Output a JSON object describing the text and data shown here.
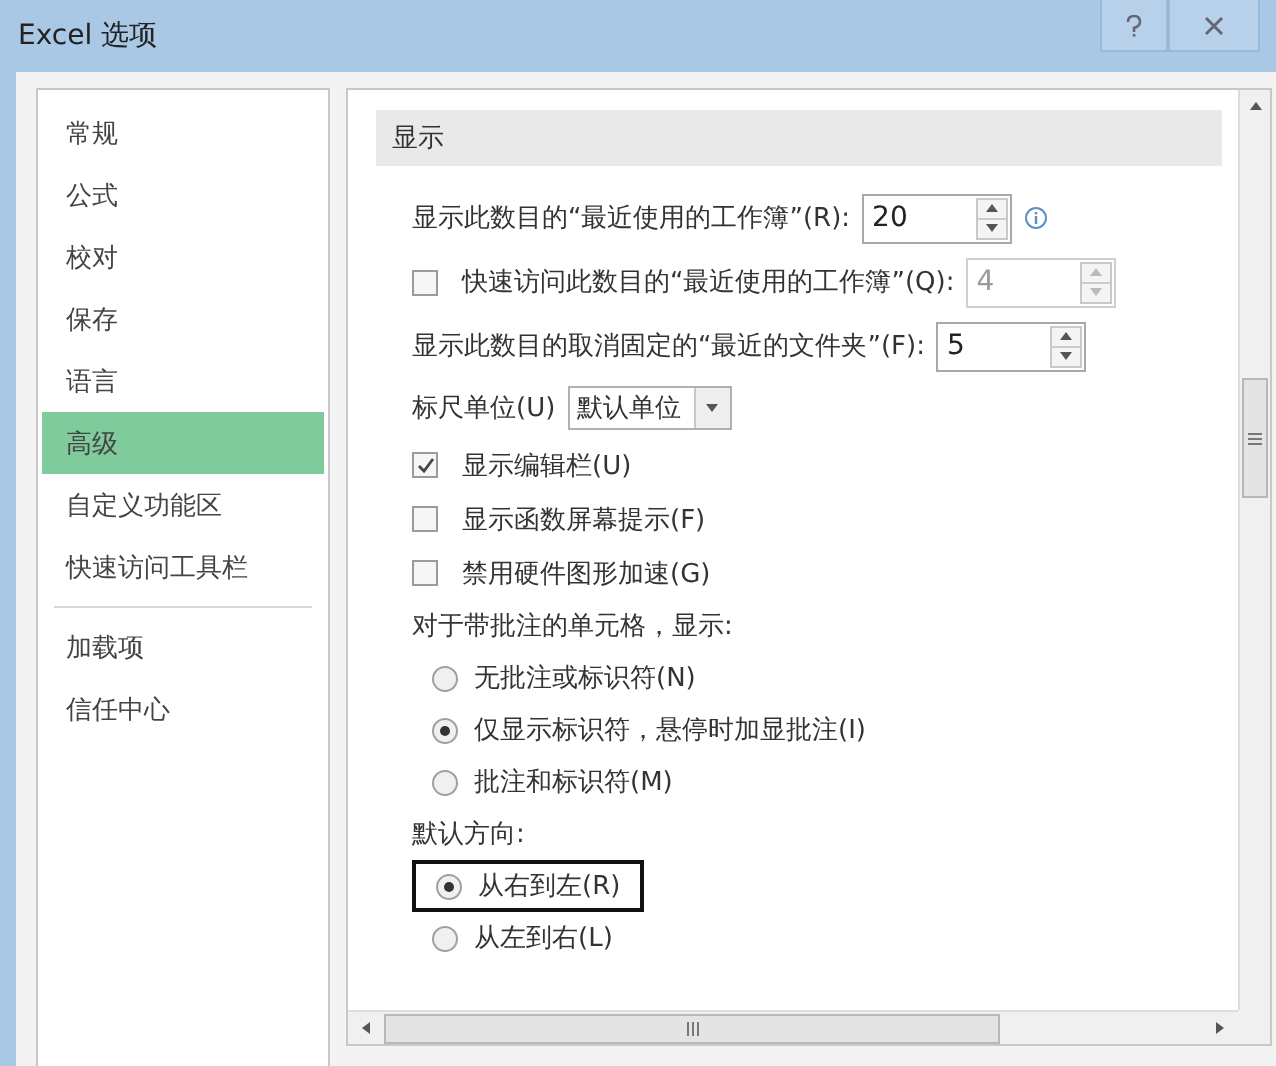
{
  "window": {
    "title": "Excel 选项"
  },
  "sidebar": {
    "groups": [
      [
        {
          "label": "常规",
          "selected": false
        },
        {
          "label": "公式",
          "selected": false
        },
        {
          "label": "校对",
          "selected": false
        },
        {
          "label": "保存",
          "selected": false
        },
        {
          "label": "语言",
          "selected": false
        },
        {
          "label": "高级",
          "selected": true
        },
        {
          "label": "自定义功能区",
          "selected": false
        },
        {
          "label": "快速访问工具栏",
          "selected": false
        }
      ],
      [
        {
          "label": "加载项",
          "selected": false
        },
        {
          "label": "信任中心",
          "selected": false
        }
      ]
    ]
  },
  "section": {
    "title": "显示",
    "options": [
      {
        "kind": "spin",
        "label": "显示此数目的“最近使用的工作簿”(R):",
        "value": "20",
        "info": true
      },
      {
        "kind": "check_spin",
        "label": "快速访问此数目的“最近使用的工作簿”(Q):",
        "value": "4",
        "checked": false,
        "disabled": true
      },
      {
        "kind": "spin",
        "label": "显示此数目的取消固定的“最近的文件夹”(F):",
        "value": "5",
        "info": false
      },
      {
        "kind": "dropdown",
        "label": "标尺单位(U)",
        "value": "默认单位"
      },
      {
        "kind": "checkbox",
        "label": "显示编辑栏(U)",
        "checked": true
      },
      {
        "kind": "checkbox",
        "label": "显示函数屏幕提示(F)",
        "checked": false
      },
      {
        "kind": "checkbox",
        "label": "禁用硬件图形加速(G)",
        "checked": false
      },
      {
        "kind": "radio_group",
        "label": "对于带批注的单元格，显示:",
        "options": [
          {
            "label": "无批注或标识符(N)",
            "selected": false,
            "highlighted": false
          },
          {
            "label": "仅显示标识符，悬停时加显批注(I)",
            "selected": true,
            "highlighted": false
          },
          {
            "label": "批注和标识符(M)",
            "selected": false,
            "highlighted": false
          }
        ]
      },
      {
        "kind": "radio_group",
        "label": "默认方向:",
        "options": [
          {
            "label": "从右到左(R)",
            "selected": true,
            "highlighted": true
          },
          {
            "label": "从左到右(L)",
            "selected": false,
            "highlighted": false
          }
        ]
      }
    ]
  }
}
